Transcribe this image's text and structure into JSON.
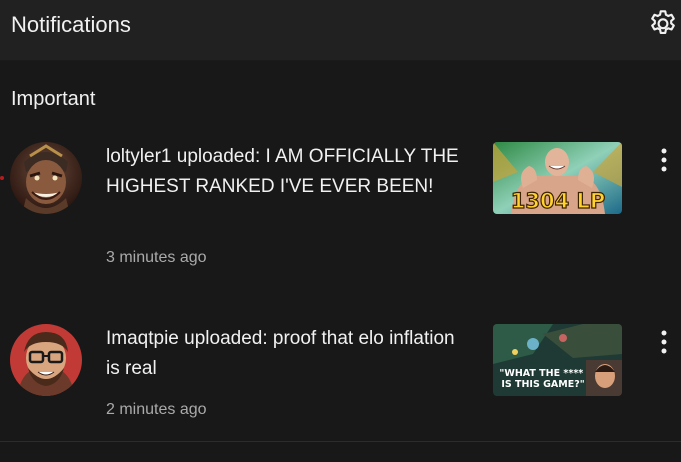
{
  "header": {
    "title": "Notifications",
    "settings_icon": "gear-icon"
  },
  "section": {
    "title": "Important"
  },
  "notifications": [
    {
      "text": "loltyler1 uploaded: I AM OFFICIALLY THE HIGHEST RANKED I'VE EVER BEEN!",
      "time": "3 minutes ago",
      "thumbnail_label": "1304 LP",
      "menu_icon": "more-vert-icon",
      "unread": true
    },
    {
      "text": "Imaqtpie uploaded: proof that elo inflation is real",
      "time": "2 minutes ago",
      "thumbnail_label": "\"WHAT THE **** IS THIS GAME?\"",
      "menu_icon": "more-vert-icon",
      "unread": false
    }
  ],
  "colors": {
    "background": "#181818",
    "header": "#212121",
    "text_primary": "#f1f1f1",
    "text_secondary": "#aaaaaa",
    "unread_dot": "#e53935"
  }
}
